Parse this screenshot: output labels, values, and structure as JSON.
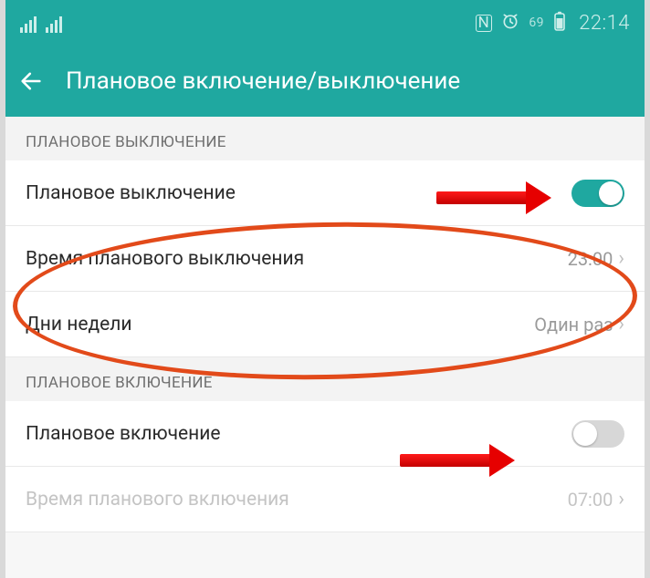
{
  "statusbar": {
    "nfc": "N",
    "battery": "69",
    "time": "22:14"
  },
  "appbar": {
    "title": "Плановое включение/выключение"
  },
  "sections": {
    "off": {
      "header": "ПЛАНОВОЕ ВЫКЛЮЧЕНИЕ",
      "toggle_label": "Плановое выключение",
      "time_label": "Время планового выключения",
      "time_value": "23:00",
      "days_label": "Дни недели",
      "days_value": "Один раз"
    },
    "on": {
      "header": "ПЛАНОВОЕ ВКЛЮЧЕНИЕ",
      "toggle_label": "Плановое включение",
      "time_label": "Время планового включения",
      "time_value": "07:00"
    }
  },
  "toggles": {
    "scheduled_off": true,
    "scheduled_on": false
  },
  "colors": {
    "accent": "#1fa8a0",
    "annotation": "#e60000",
    "ellipse": "#e24a1a"
  }
}
